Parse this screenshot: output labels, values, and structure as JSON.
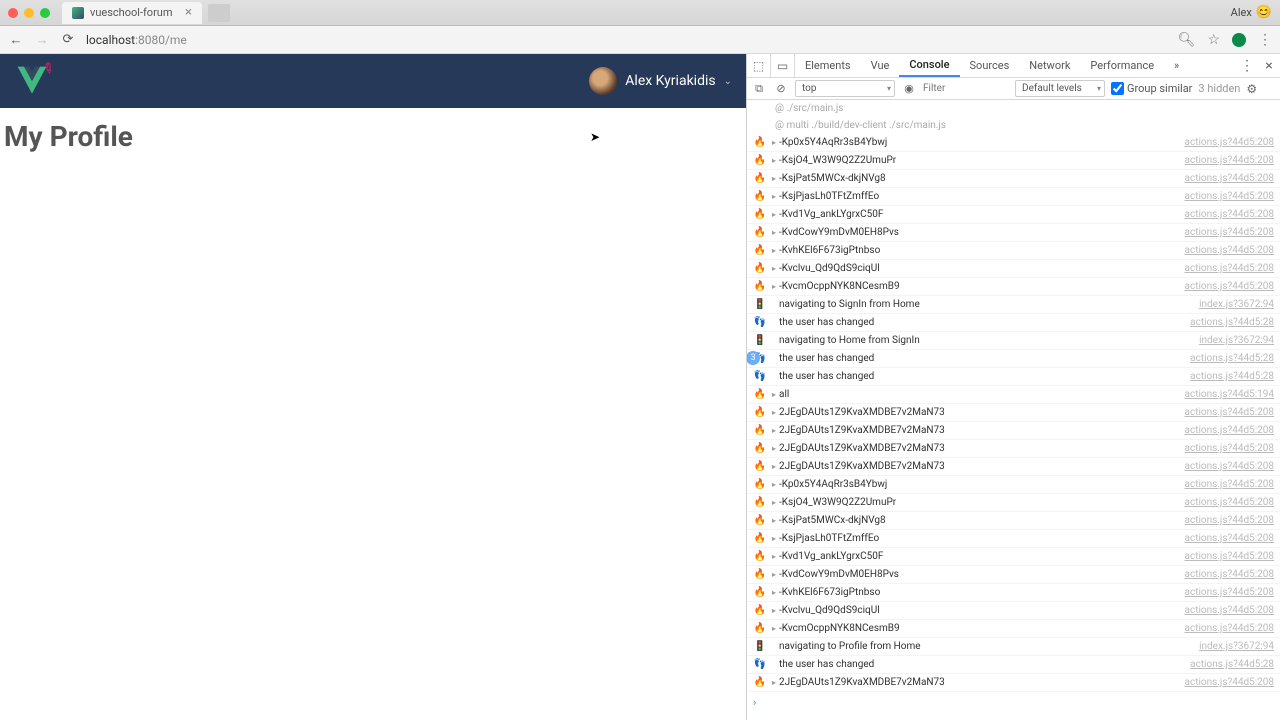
{
  "chrome": {
    "tab_title": "vueschool-forum",
    "ext_user": "Alex",
    "url_prefix": "localhost",
    "url_rest": ":8080/me"
  },
  "app": {
    "username": "Alex Kyriakidis",
    "page_title": "My Profile"
  },
  "devtools": {
    "tabs": [
      "Elements",
      "Vue",
      "Console",
      "Sources",
      "Network",
      "Performance"
    ],
    "active": "Console",
    "context": "top",
    "filter_placeholder": "Filter",
    "levels_label": "Default levels",
    "group_label": "Group similar",
    "hidden_label": "3 hidden",
    "stack": [
      "@ ./src/main.js",
      "@ multi ./build/dev-client ./src/main.js"
    ],
    "rows": [
      {
        "ic": "🔥",
        "exp": "▸",
        "msg": "-Kp0x5Y4AqRr3sB4Ybwj",
        "src": "actions.js?44d5:208"
      },
      {
        "ic": "🔥",
        "exp": "▸",
        "msg": "-KsjO4_W3W9Q2Z2UmuPr",
        "src": "actions.js?44d5:208"
      },
      {
        "ic": "🔥",
        "exp": "▸",
        "msg": "-KsjPat5MWCx-dkjNVg8",
        "src": "actions.js?44d5:208"
      },
      {
        "ic": "🔥",
        "exp": "▸",
        "msg": "-KsjPjasLh0TFtZmffEo",
        "src": "actions.js?44d5:208"
      },
      {
        "ic": "🔥",
        "exp": "▸",
        "msg": "-Kvd1Vg_ankLYgrxC50F",
        "src": "actions.js?44d5:208"
      },
      {
        "ic": "🔥",
        "exp": "▸",
        "msg": "-KvdCowY9mDvM0EH8Pvs",
        "src": "actions.js?44d5:208"
      },
      {
        "ic": "🔥",
        "exp": "▸",
        "msg": "-KvhKEl6F673igPtnbso",
        "src": "actions.js?44d5:208"
      },
      {
        "ic": "🔥",
        "exp": "▸",
        "msg": "-Kvclvu_Qd9QdS9ciqUl",
        "src": "actions.js?44d5:208"
      },
      {
        "ic": "🔥",
        "exp": "▸",
        "msg": "-KvcmOcppNYK8NCesmB9",
        "src": "actions.js?44d5:208"
      },
      {
        "ic": "🚦",
        "exp": "",
        "msg": "navigating to SignIn from Home",
        "src": "index.js?3672:94"
      },
      {
        "ic": "👣",
        "exp": "",
        "msg": "the user has changed",
        "src": "actions.js?44d5:28"
      },
      {
        "ic": "🚦",
        "exp": "",
        "msg": "navigating to Home from SignIn",
        "src": "index.js?3672:94"
      },
      {
        "ic": "👣",
        "exp": "",
        "msg": "the user has changed",
        "src": "actions.js?44d5:28",
        "badge": "3"
      },
      {
        "ic": "👣",
        "exp": "",
        "msg": "the user has changed",
        "src": "actions.js?44d5:28"
      },
      {
        "ic": "🔥",
        "exp": "▸",
        "msg": "all",
        "src": "actions.js?44d5:194"
      },
      {
        "ic": "🔥",
        "exp": "▸",
        "msg": "2JEgDAUts1Z9KvaXMDBE7v2MaN73",
        "src": "actions.js?44d5:208"
      },
      {
        "ic": "🔥",
        "exp": "▸",
        "msg": "2JEgDAUts1Z9KvaXMDBE7v2MaN73",
        "src": "actions.js?44d5:208"
      },
      {
        "ic": "🔥",
        "exp": "▸",
        "msg": "2JEgDAUts1Z9KvaXMDBE7v2MaN73",
        "src": "actions.js?44d5:208"
      },
      {
        "ic": "🔥",
        "exp": "▸",
        "msg": "2JEgDAUts1Z9KvaXMDBE7v2MaN73",
        "src": "actions.js?44d5:208"
      },
      {
        "ic": "🔥",
        "exp": "▸",
        "msg": "-Kp0x5Y4AqRr3sB4Ybwj",
        "src": "actions.js?44d5:208"
      },
      {
        "ic": "🔥",
        "exp": "▸",
        "msg": "-KsjO4_W3W9Q2Z2UmuPr",
        "src": "actions.js?44d5:208"
      },
      {
        "ic": "🔥",
        "exp": "▸",
        "msg": "-KsjPat5MWCx-dkjNVg8",
        "src": "actions.js?44d5:208"
      },
      {
        "ic": "🔥",
        "exp": "▸",
        "msg": "-KsjPjasLh0TFtZmffEo",
        "src": "actions.js?44d5:208"
      },
      {
        "ic": "🔥",
        "exp": "▸",
        "msg": "-Kvd1Vg_ankLYgrxC50F",
        "src": "actions.js?44d5:208"
      },
      {
        "ic": "🔥",
        "exp": "▸",
        "msg": "-KvdCowY9mDvM0EH8Pvs",
        "src": "actions.js?44d5:208"
      },
      {
        "ic": "🔥",
        "exp": "▸",
        "msg": "-KvhKEl6F673igPtnbso",
        "src": "actions.js?44d5:208"
      },
      {
        "ic": "🔥",
        "exp": "▸",
        "msg": "-Kvclvu_Qd9QdS9ciqUl",
        "src": "actions.js?44d5:208"
      },
      {
        "ic": "🔥",
        "exp": "▸",
        "msg": "-KvcmOcppNYK8NCesmB9",
        "src": "actions.js?44d5:208"
      },
      {
        "ic": "🚦",
        "exp": "",
        "msg": "navigating to Profile from Home",
        "src": "index.js?3672:94"
      },
      {
        "ic": "👣",
        "exp": "",
        "msg": "the user has changed",
        "src": "actions.js?44d5:28"
      },
      {
        "ic": "🔥",
        "exp": "▸",
        "msg": "2JEgDAUts1Z9KvaXMDBE7v2MaN73",
        "src": "actions.js?44d5:208"
      }
    ]
  }
}
